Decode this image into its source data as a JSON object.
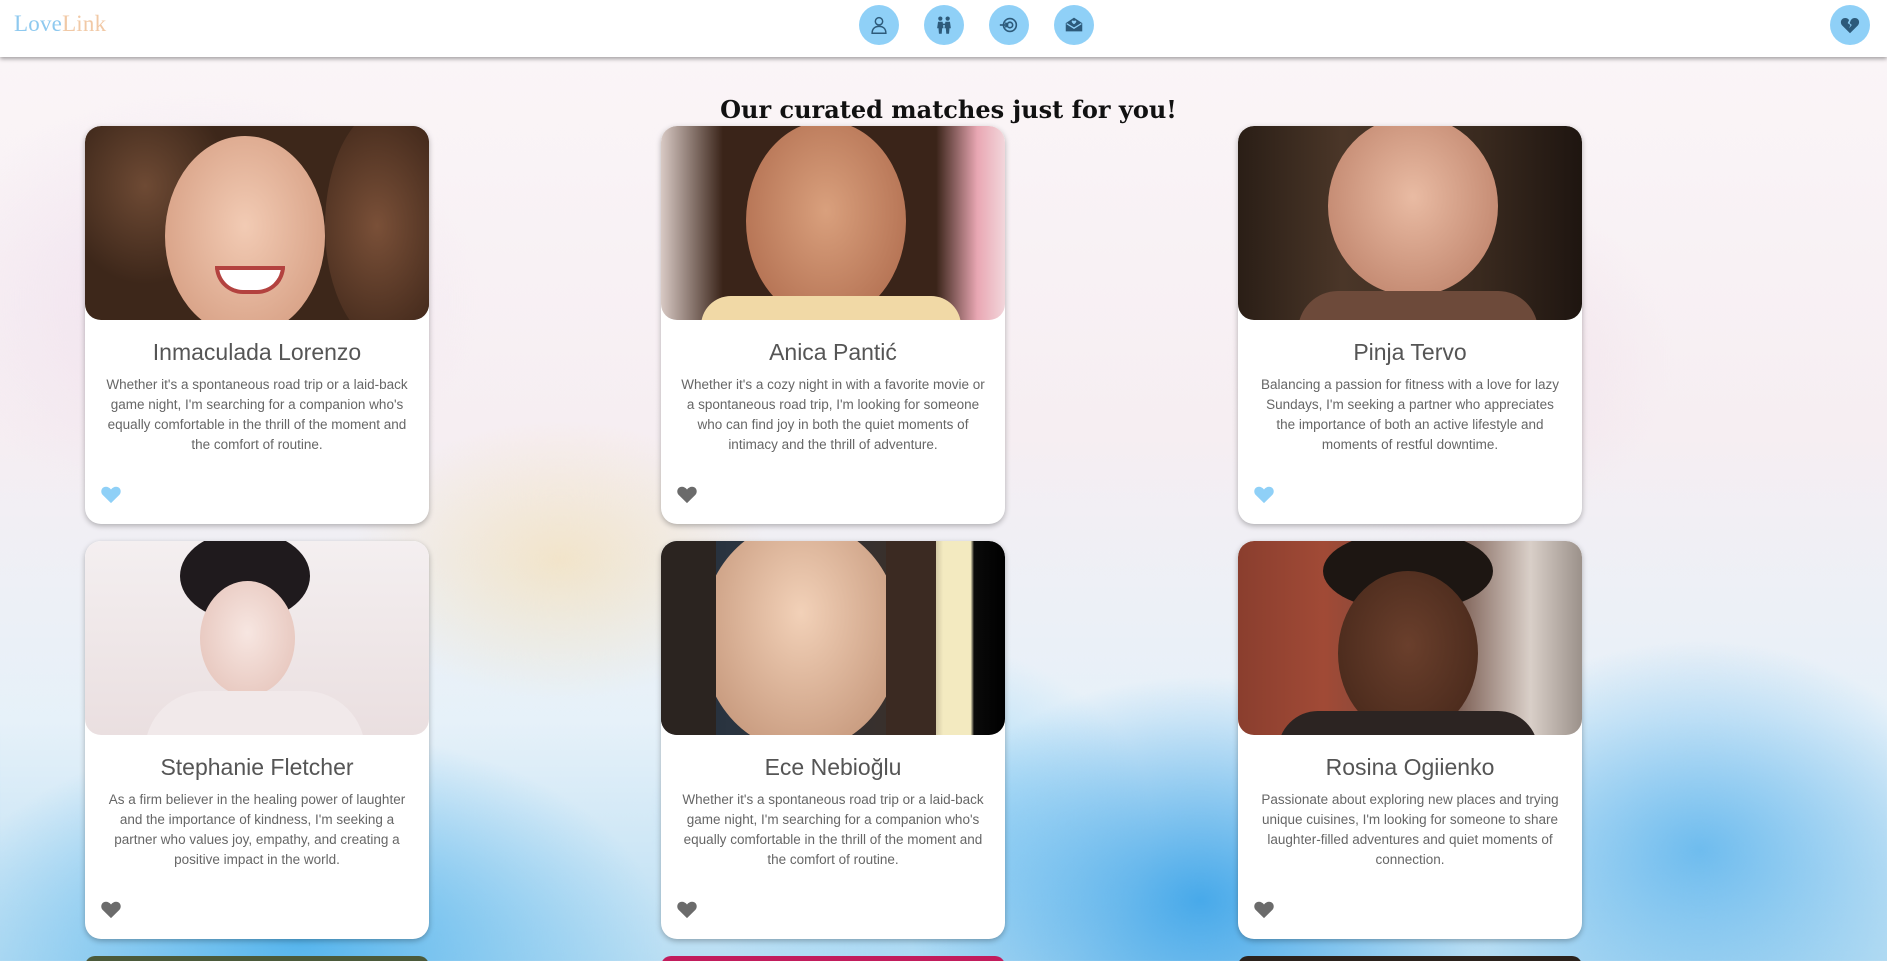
{
  "app": {
    "logo_part1": "Love",
    "logo_part2": "Link"
  },
  "nav": {
    "items": [
      {
        "icon": "profile-icon"
      },
      {
        "icon": "couple-icon"
      },
      {
        "icon": "match-icon"
      },
      {
        "icon": "messages-icon"
      }
    ],
    "logout_icon": "broken-heart-icon"
  },
  "page": {
    "title": "Our curated matches just for you!"
  },
  "colors": {
    "accent": "#8fd0f7",
    "liked": "#8fd0f7",
    "unliked": "#6b6b6b",
    "logo_love": "#8ec9ef",
    "logo_link": "#f1c9a6"
  },
  "matches": [
    {
      "name": "Inmaculada Lorenzo",
      "bio": "Whether it's a spontaneous road trip or a laid-back game night, I'm searching for a companion who's equally comfortable in the thrill of the moment and the comfort of routine.",
      "liked": true
    },
    {
      "name": "Anica Pantić",
      "bio": "Whether it's a cozy night in with a favorite movie or a spontaneous road trip, I'm looking for someone who can find joy in both the quiet moments of intimacy and the thrill of adventure.",
      "liked": false
    },
    {
      "name": "Pinja Tervo",
      "bio": "Balancing a passion for fitness with a love for lazy Sundays, I'm seeking a partner who appreciates the importance of both an active lifestyle and moments of restful downtime.",
      "liked": true
    },
    {
      "name": "Stephanie Fletcher",
      "bio": "As a firm believer in the healing power of laughter and the importance of kindness, I'm seeking a partner who values joy, empathy, and creating a positive impact in the world.",
      "liked": false
    },
    {
      "name": "Ece Nebioğlu",
      "bio": "Whether it's a spontaneous road trip or a laid-back game night, I'm searching for a companion who's equally comfortable in the thrill of the moment and the comfort of routine.",
      "liked": false
    },
    {
      "name": "Rosina Ogiienko",
      "bio": "Passionate about exploring new places and trying unique cuisines, I'm looking for someone to share laughter-filled adventures and quiet moments of connection.",
      "liked": false
    }
  ]
}
